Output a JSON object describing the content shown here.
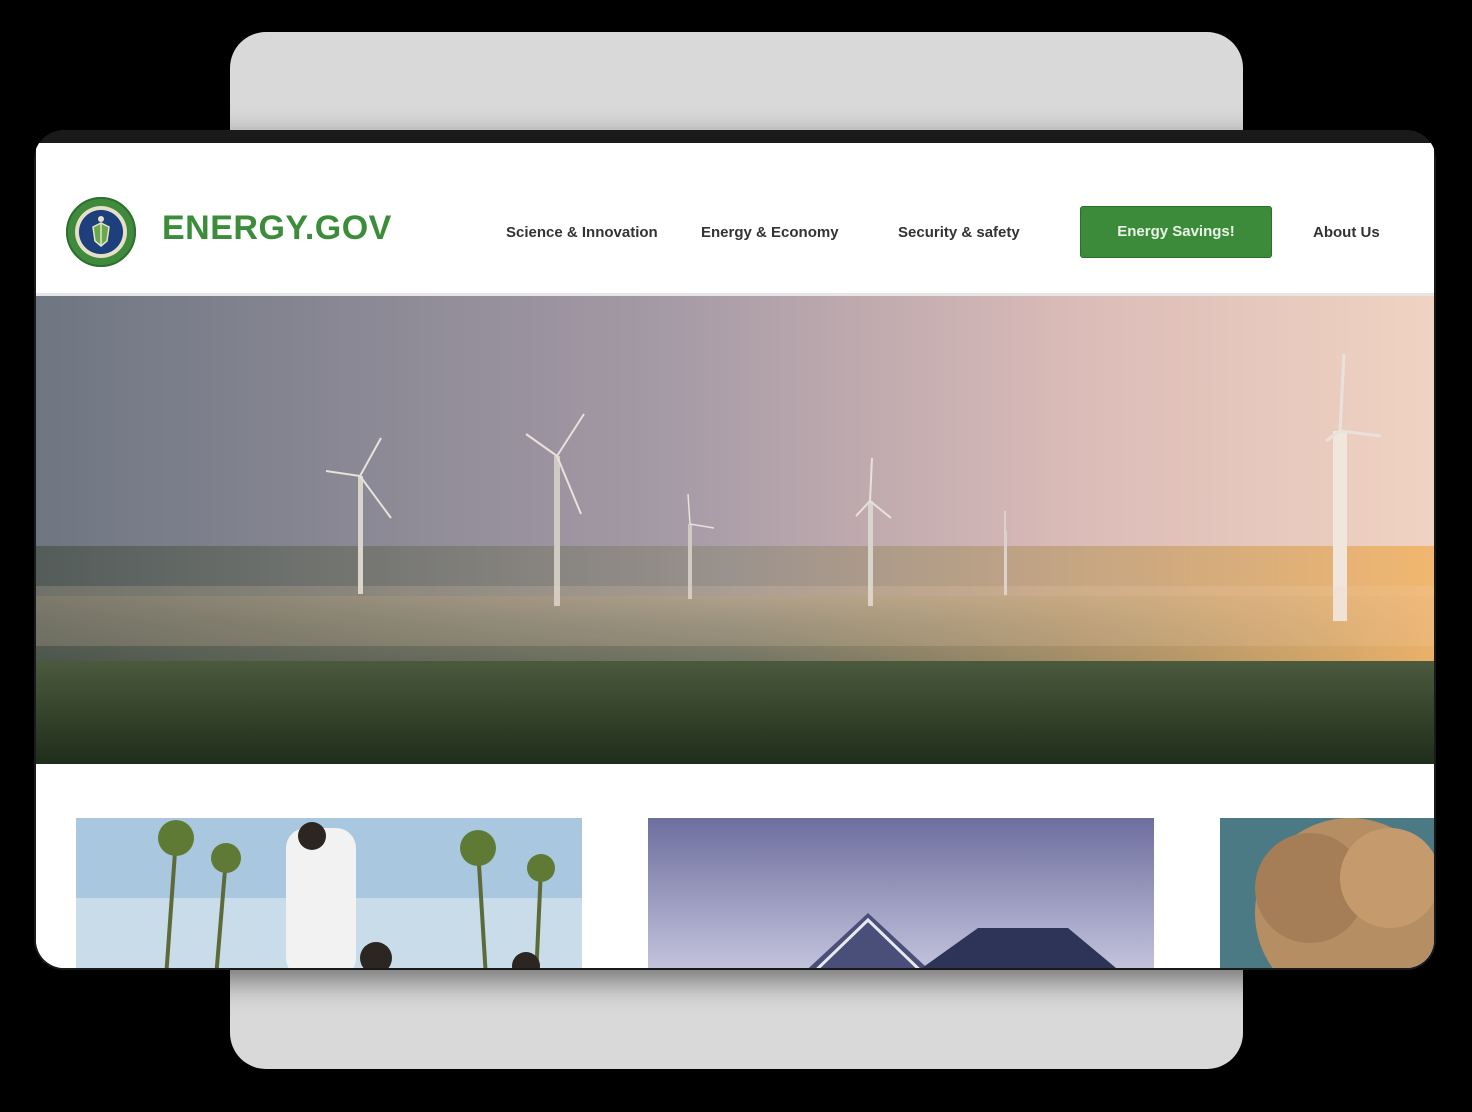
{
  "site": {
    "brand": "ENERGY.GOV",
    "logo_icon": "doe-seal-icon"
  },
  "nav": {
    "items": [
      {
        "label": "Science & Innovation"
      },
      {
        "label": "Energy & Economy"
      },
      {
        "label": "Security & safety"
      },
      {
        "label": "Energy Savings!"
      },
      {
        "label": "About Us"
      }
    ],
    "cta_color": "#3c8b3b"
  },
  "colors": {
    "brand_green": "#3b8d3a",
    "background_panel": "#d9d9d9"
  },
  "hero": {
    "image": "wind-turbines-landscape"
  },
  "cards": [
    {
      "image": "students-planting-trees"
    },
    {
      "image": "house-with-solar-panels"
    },
    {
      "image": "autumn-tree"
    }
  ]
}
